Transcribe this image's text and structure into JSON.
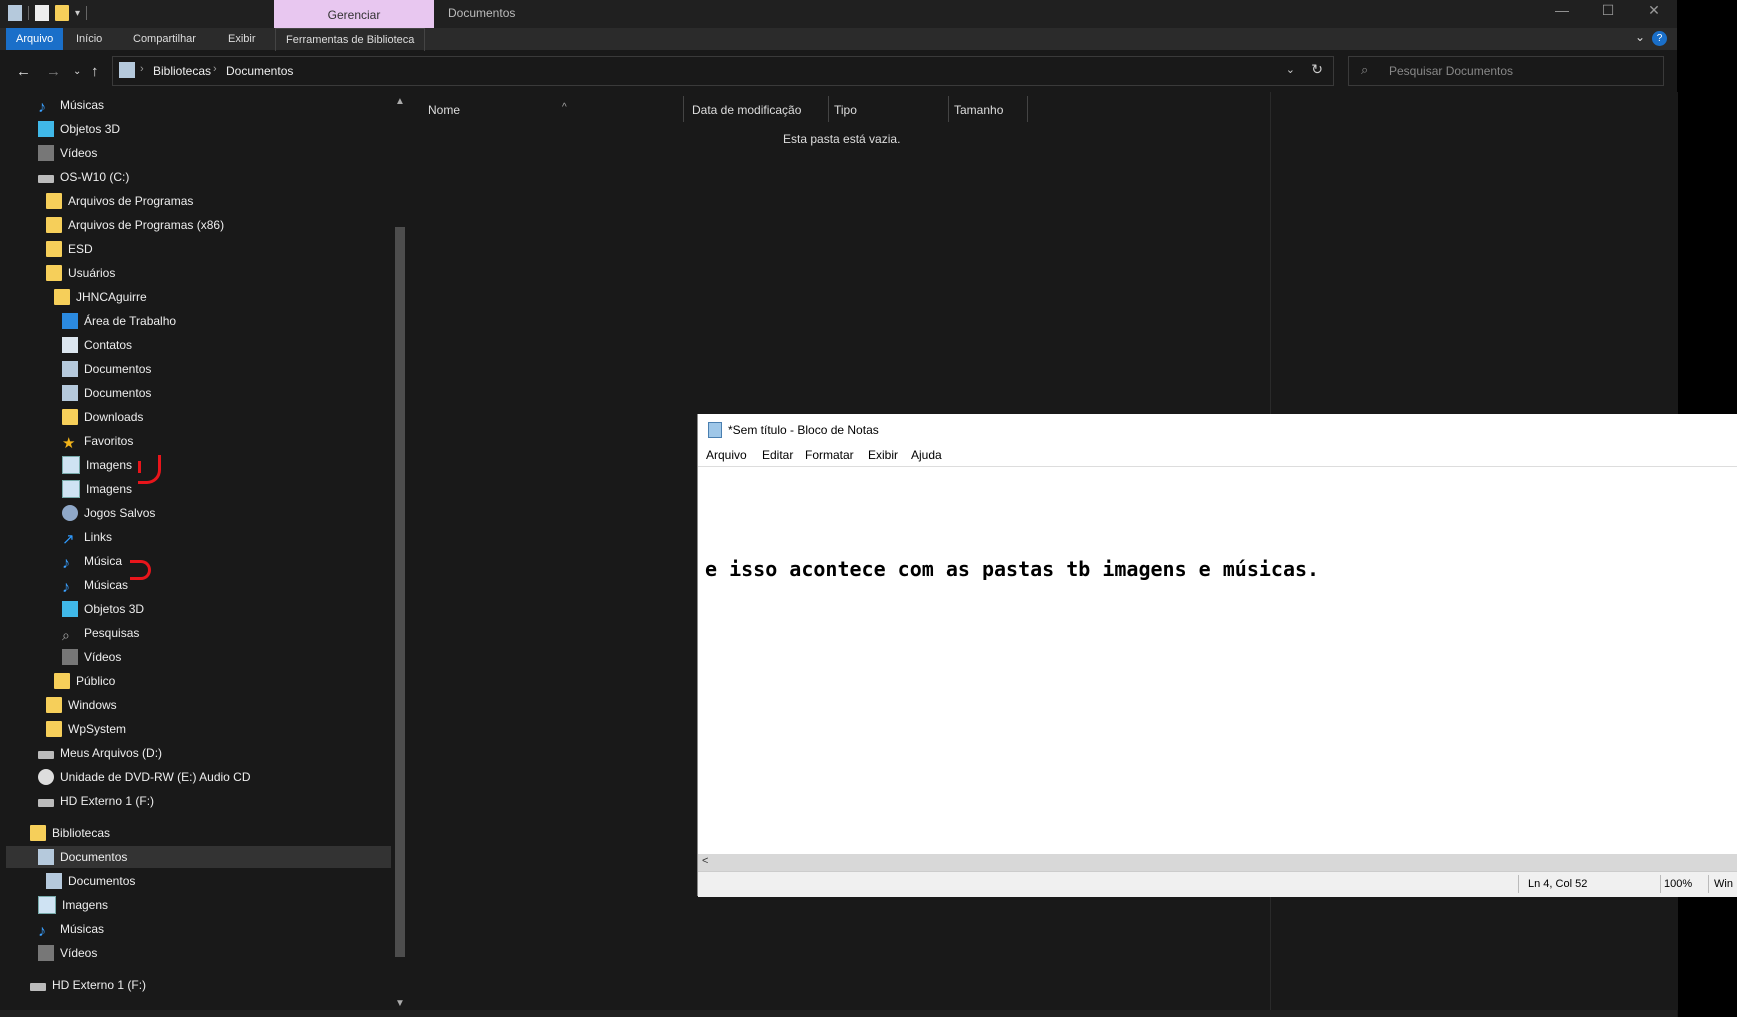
{
  "explorer": {
    "manage_tab": "Gerenciar",
    "window_title": "Documentos",
    "ribbon_tabs": [
      "Arquivo",
      "Início",
      "Compartilhar",
      "Exibir",
      "Ferramentas de Biblioteca"
    ],
    "breadcrumb": [
      "Bibliotecas",
      "Documentos"
    ],
    "search_placeholder": "Pesquisar Documentos",
    "columns": [
      "Nome",
      "Data de modificação",
      "Tipo",
      "Tamanho"
    ],
    "empty_message": "Esta pasta está vazia.",
    "accent_color": "#1a6fc9",
    "manage_color": "#e8c7f0"
  },
  "nav": {
    "items": [
      {
        "label": "Músicas",
        "icon": "music-icon"
      },
      {
        "label": "Objetos 3D",
        "icon": "3d-objects-icon"
      },
      {
        "label": "Vídeos",
        "icon": "videos-icon"
      },
      {
        "label": "OS-W10 (C:)",
        "icon": "drive-icon"
      },
      {
        "label": "Arquivos de Programas",
        "icon": "folder-icon"
      },
      {
        "label": "Arquivos de Programas (x86)",
        "icon": "folder-icon"
      },
      {
        "label": "ESD",
        "icon": "folder-icon"
      },
      {
        "label": "Usuários",
        "icon": "folder-icon"
      },
      {
        "label": "JHNCAguirre",
        "icon": "folder-icon"
      },
      {
        "label": "Área de Trabalho",
        "icon": "desktop-icon"
      },
      {
        "label": "Contatos",
        "icon": "contacts-icon"
      },
      {
        "label": "Documentos",
        "icon": "documents-icon"
      },
      {
        "label": "Documentos",
        "icon": "documents-icon"
      },
      {
        "label": "Downloads",
        "icon": "folder-icon"
      },
      {
        "label": "Favoritos",
        "icon": "star-icon"
      },
      {
        "label": "Imagens",
        "icon": "pictures-icon"
      },
      {
        "label": "Imagens",
        "icon": "pictures-icon"
      },
      {
        "label": "Jogos Salvos",
        "icon": "saved-games-icon"
      },
      {
        "label": "Links",
        "icon": "link-icon"
      },
      {
        "label": "Música",
        "icon": "music-icon"
      },
      {
        "label": "Músicas",
        "icon": "music-icon"
      },
      {
        "label": "Objetos 3D",
        "icon": "3d-objects-icon"
      },
      {
        "label": "Pesquisas",
        "icon": "search-icon"
      },
      {
        "label": "Vídeos",
        "icon": "videos-icon"
      },
      {
        "label": "Público",
        "icon": "folder-icon"
      },
      {
        "label": "Windows",
        "icon": "folder-icon"
      },
      {
        "label": "WpSystem",
        "icon": "folder-icon"
      },
      {
        "label": "Meus Arquivos (D:)",
        "icon": "drive-icon"
      },
      {
        "label": "Unidade de DVD-RW (E:) Audio CD",
        "icon": "dvd-icon"
      },
      {
        "label": "HD Externo 1 (F:)",
        "icon": "drive-icon"
      },
      {
        "label": "Bibliotecas",
        "icon": "libraries-icon"
      },
      {
        "label": "Documentos",
        "icon": "documents-icon"
      },
      {
        "label": "Documentos",
        "icon": "documents-icon"
      },
      {
        "label": "Imagens",
        "icon": "pictures-icon"
      },
      {
        "label": "Músicas",
        "icon": "music-icon"
      },
      {
        "label": "Vídeos",
        "icon": "videos-icon"
      },
      {
        "label": "HD Externo 1 (F:)",
        "icon": "drive-icon"
      }
    ]
  },
  "notepad": {
    "title": "*Sem título - Bloco de Notas",
    "menu": [
      "Arquivo",
      "Editar",
      "Formatar",
      "Exibir",
      "Ajuda"
    ],
    "text": "e isso acontece com as pastas tb imagens e músicas.",
    "status_position": "Ln 4, Col 52",
    "status_zoom": "100%",
    "status_eol": "Win"
  },
  "annotation_color": "#e8151b"
}
